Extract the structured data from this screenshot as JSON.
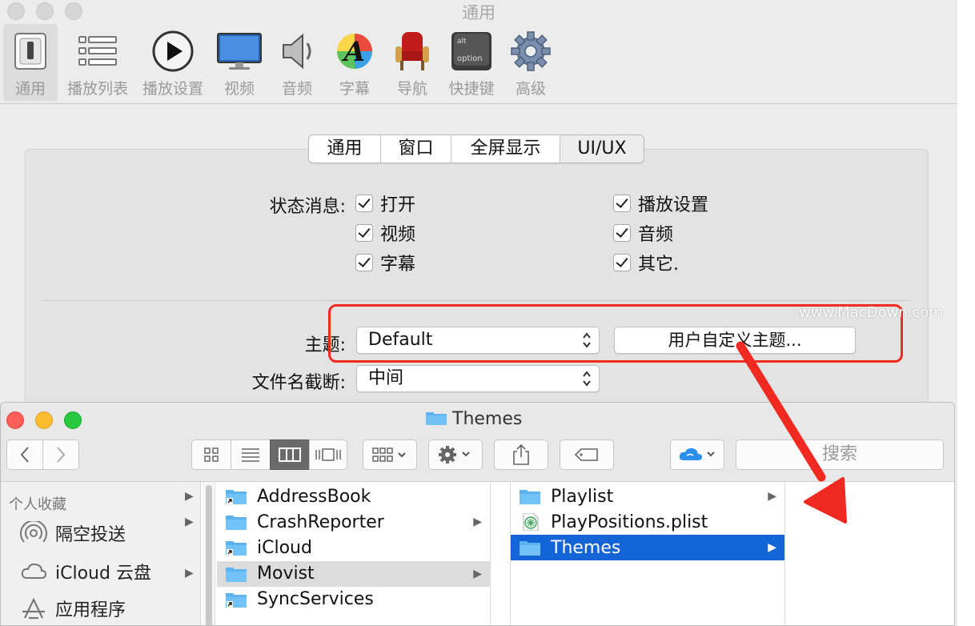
{
  "prefs_window": {
    "title": "通用",
    "toolbar": [
      {
        "label": "通用",
        "icon": "switch-icon",
        "selected": true
      },
      {
        "label": "播放列表",
        "icon": "list-icon"
      },
      {
        "label": "播放设置",
        "icon": "play-icon"
      },
      {
        "label": "视频",
        "icon": "monitor-icon"
      },
      {
        "label": "音频",
        "icon": "speaker-icon"
      },
      {
        "label": "字幕",
        "icon": "font-icon"
      },
      {
        "label": "导航",
        "icon": "theater-seat-icon"
      },
      {
        "label": "快捷键",
        "icon": "option-key-icon"
      },
      {
        "label": "高级",
        "icon": "gear-icon"
      }
    ],
    "tabs": [
      "通用",
      "窗口",
      "全屏显示",
      "UI/UX"
    ],
    "selected_tab": "UI/UX",
    "status_label": "状态消息:",
    "checkboxes": [
      {
        "label": "打开",
        "checked": true
      },
      {
        "label": "播放设置",
        "checked": true
      },
      {
        "label": "视频",
        "checked": true
      },
      {
        "label": "音频",
        "checked": true
      },
      {
        "label": "字幕",
        "checked": true
      },
      {
        "label": "其它.",
        "checked": true
      }
    ],
    "theme_label": "主题:",
    "theme_value": "Default",
    "custom_theme_button": "用户自定义主题...",
    "filename_label": "文件名截断:",
    "filename_value": "中间",
    "watermark": "www.MacDown.com"
  },
  "finder": {
    "title": "Themes",
    "search_placeholder": "搜索",
    "sidebar_heading": "个人收藏",
    "sidebar_items": [
      "隔空投送",
      "iCloud 云盘",
      "应用程序"
    ],
    "column1": [
      {
        "name": "AddressBook",
        "alias": true
      },
      {
        "name": "CrashReporter",
        "arrow": true
      },
      {
        "name": "iCloud",
        "alias": true
      },
      {
        "name": "Movist",
        "arrow": true,
        "state": "gray"
      },
      {
        "name": "SyncServices",
        "alias": true
      }
    ],
    "column2": [
      {
        "name": "Playlist",
        "arrow": true
      },
      {
        "name": "PlayPositions.plist",
        "type": "plist"
      },
      {
        "name": "Themes",
        "arrow": true,
        "state": "selected"
      }
    ]
  },
  "colors": {
    "highlight": "#f02a20",
    "selection": "#1364d6",
    "folder": "#5cb3f0"
  }
}
